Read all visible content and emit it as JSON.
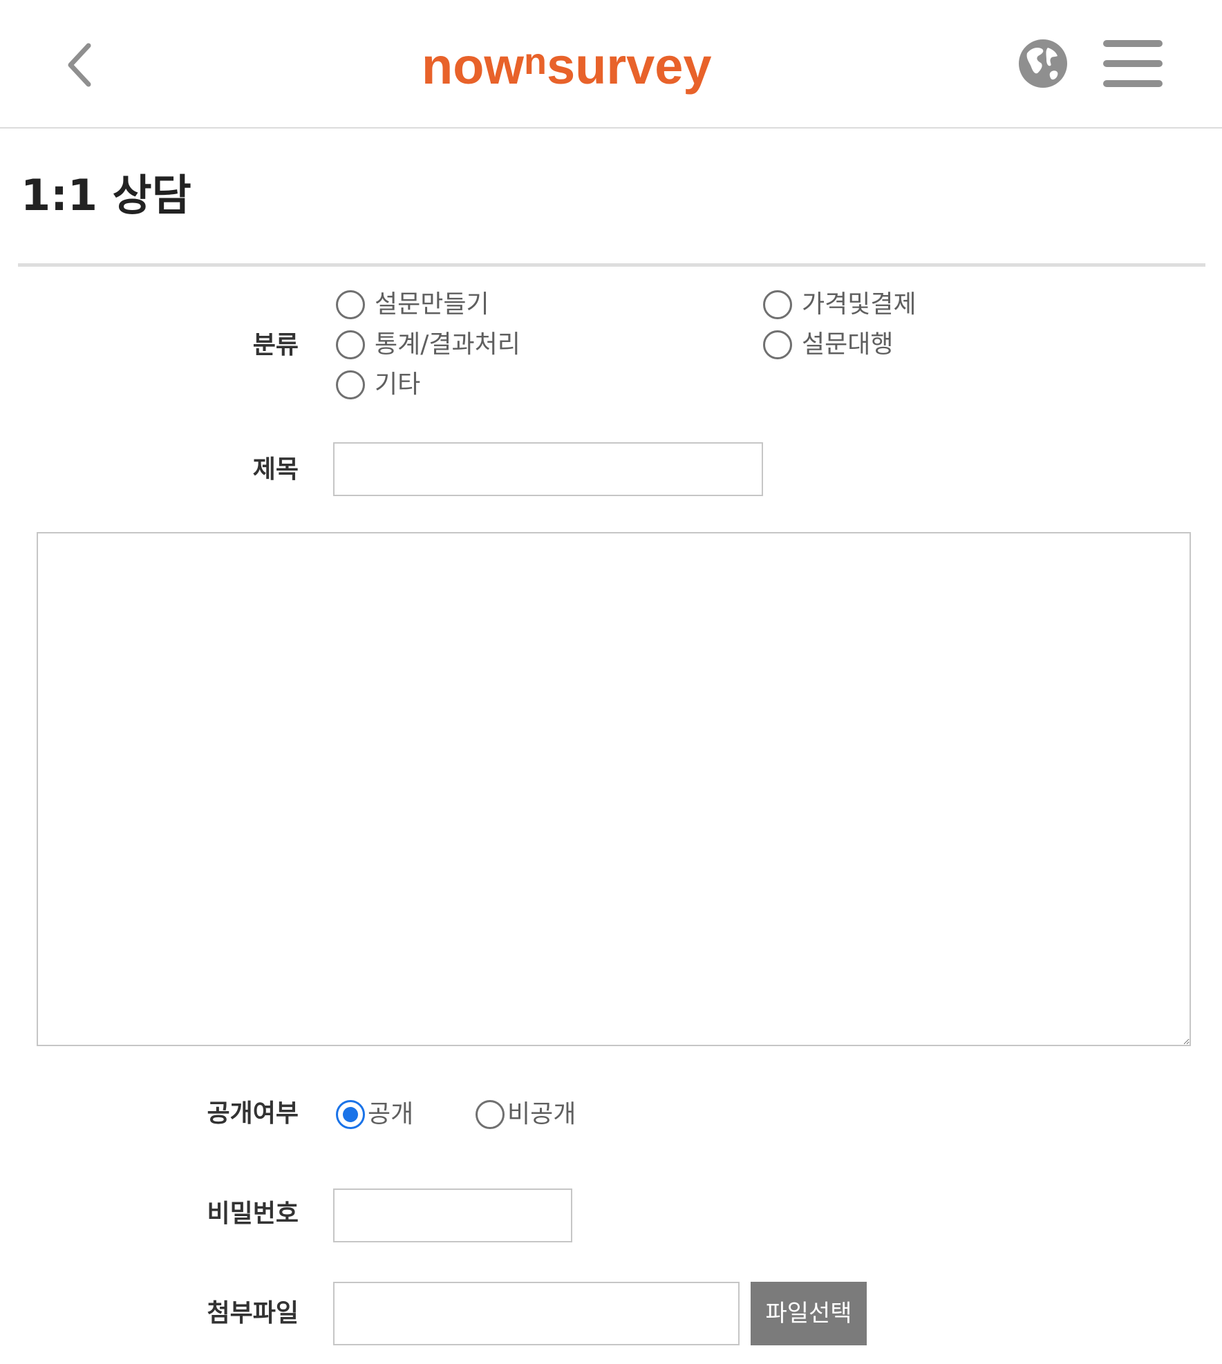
{
  "header": {
    "logo": {
      "part1": "now",
      "sup": "n",
      "part2": "survey"
    },
    "colors": {
      "brand": "#e8622a",
      "icon_gray": "#8f8f8f"
    },
    "icons": {
      "back": "chevron-left-icon",
      "globe": "globe-icon",
      "menu": "hamburger-menu-icon"
    }
  },
  "page": {
    "title": "1:1 상담"
  },
  "form": {
    "category": {
      "label": "분류",
      "options": [
        "설문만들기",
        "가격및결제",
        "통계/결과처리",
        "설문대행",
        "기타"
      ]
    },
    "subject": {
      "label": "제목",
      "value": ""
    },
    "body": {
      "value": ""
    },
    "visibility": {
      "label": "공개여부",
      "options": [
        "공개",
        "비공개"
      ],
      "selected": "공개",
      "accent_color": "#1a73e8"
    },
    "password": {
      "label": "비밀번호",
      "value": ""
    },
    "attachment": {
      "label": "첨부파일",
      "value": "",
      "button_label": "파일선택"
    }
  }
}
